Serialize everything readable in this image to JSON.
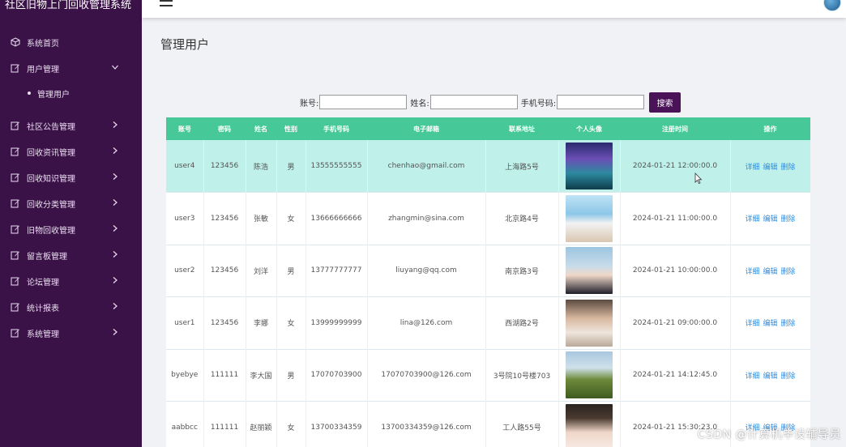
{
  "app": {
    "title": "社区旧物上门回收管理系统"
  },
  "sidebar": {
    "items": [
      {
        "label": "系统首页",
        "icon": "cube-icon",
        "expandable": false
      },
      {
        "label": "用户管理",
        "icon": "edit-icon",
        "expandable": true,
        "expanded": true
      },
      {
        "label": "社区公告管理",
        "icon": "edit-icon",
        "expandable": true
      },
      {
        "label": "回收资讯管理",
        "icon": "edit-icon",
        "expandable": true
      },
      {
        "label": "回收知识管理",
        "icon": "edit-icon",
        "expandable": true
      },
      {
        "label": "回收分类管理",
        "icon": "edit-icon",
        "expandable": true
      },
      {
        "label": "旧物回收管理",
        "icon": "edit-icon",
        "expandable": true
      },
      {
        "label": "留言板管理",
        "icon": "edit-icon",
        "expandable": true
      },
      {
        "label": "论坛管理",
        "icon": "edit-icon",
        "expandable": true
      },
      {
        "label": "统计报表",
        "icon": "edit-icon",
        "expandable": true
      },
      {
        "label": "系统管理",
        "icon": "edit-icon",
        "expandable": true
      }
    ],
    "sub_items": [
      {
        "label": "管理用户"
      }
    ]
  },
  "page": {
    "title": "管理用户"
  },
  "search": {
    "account_label": "账号:",
    "name_label": "姓名:",
    "phone_label": "手机号码:",
    "account_value": "",
    "name_value": "",
    "phone_value": "",
    "button_label": "搜索"
  },
  "table": {
    "headers": [
      "账号",
      "密码",
      "姓名",
      "性别",
      "手机号码",
      "电子邮箱",
      "联系地址",
      "个人头像",
      "注册时间",
      "操作"
    ],
    "rows": [
      {
        "account": "user4",
        "password": "123456",
        "name": "陈浩",
        "gender": "男",
        "phone": "13555555555",
        "email": "chenhao@gmail.com",
        "address": "上海路5号",
        "avatar": "avatar-bicycle-night",
        "reg_time": "2024-01-21 12:00:00.0",
        "highlight": true
      },
      {
        "account": "user3",
        "password": "123456",
        "name": "张敏",
        "gender": "女",
        "phone": "13666666666",
        "email": "zhangmin@sina.com",
        "address": "北京路4号",
        "avatar": "avatar-girl-beach",
        "reg_time": "2024-01-21 11:00:00.0",
        "highlight": false
      },
      {
        "account": "user2",
        "password": "123456",
        "name": "刘洋",
        "gender": "男",
        "phone": "13777777777",
        "email": "liuyang@qq.com",
        "address": "南京路3号",
        "avatar": "avatar-anime-boy",
        "reg_time": "2024-01-21 10:00:00.0",
        "highlight": false
      },
      {
        "account": "user1",
        "password": "123456",
        "name": "李娜",
        "gender": "女",
        "phone": "13999999999",
        "email": "lina@126.com",
        "address": "西湖路2号",
        "avatar": "avatar-girl-scarf",
        "reg_time": "2024-01-21 09:00:00.0",
        "highlight": false
      },
      {
        "account": "byebye",
        "password": "111111",
        "name": "李大国",
        "gender": "男",
        "phone": "17070703900",
        "email": "17070703900@126.com",
        "address": "3号院10号楼703",
        "avatar": "avatar-field-person",
        "reg_time": "2024-01-21 14:12:45.0",
        "highlight": false
      },
      {
        "account": "aabbcc",
        "password": "111111",
        "name": "赵丽颖",
        "gender": "女",
        "phone": "13700334359",
        "email": "13700334359@126.com",
        "address": "工人路55号",
        "avatar": "avatar-girl-portrait",
        "reg_time": "2024-01-21 15:30:23.0",
        "highlight": false
      }
    ],
    "actions": {
      "detail": "详细",
      "edit": "编辑",
      "delete": "删除"
    }
  },
  "watermark": "CSDN @计算机毕设辅导员",
  "colors": {
    "sidebar_bg": "#3b1248",
    "header_row": "#46c898",
    "highlight_row": "#bff0ea",
    "search_button": "#4a1357",
    "link": "#2f8ee0"
  }
}
